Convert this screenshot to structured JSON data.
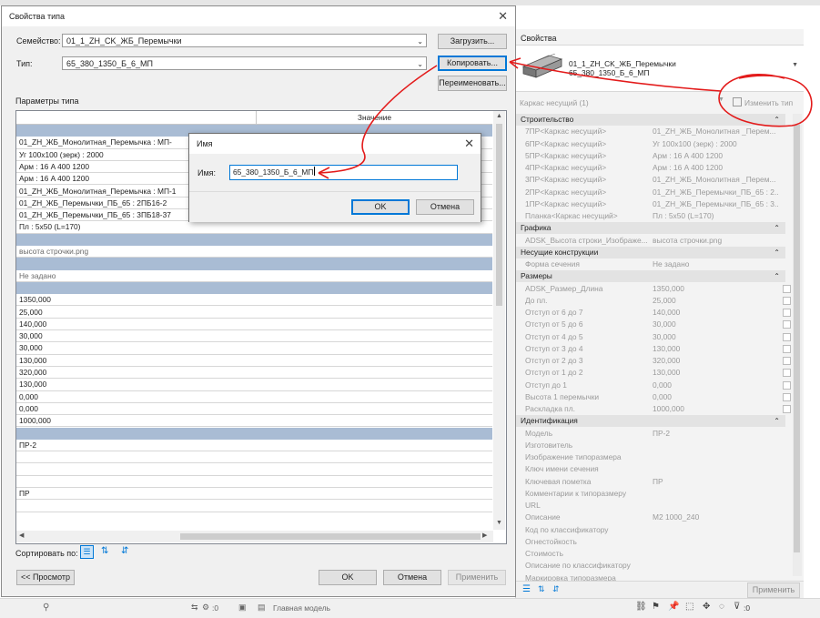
{
  "dialog": {
    "title": "Свойства типа",
    "family_label": "Семейство:",
    "family_value": "01_1_ZH_CK_ЖБ_Перемычки",
    "type_label": "Тип:",
    "type_value": "65_380_1350_Б_6_МП",
    "load_button": "Загрузить...",
    "copy_button": "Копировать...",
    "rename_button": "Переименовать...",
    "params_label": "Параметры типа",
    "column_header": "Значение",
    "sort_label": "Сортировать по:",
    "preview_button": "<< Просмотр",
    "ok_button": "OK",
    "cancel_button": "Отмена",
    "apply_button": "Применить",
    "rows": [
      {
        "text": "",
        "band": true
      },
      {
        "text": "01_ZH_ЖБ_Монолитная_Перемычка : МП-",
        "band": false
      },
      {
        "text": "Уг 100x100 (зерк) : 2000",
        "band": false
      },
      {
        "text": "Арм : 16 A 400 1200",
        "band": false
      },
      {
        "text": "Арм : 16 A 400 1200",
        "band": false
      },
      {
        "text": "01_ZH_ЖБ_Монолитная_Перемычка : МП-1",
        "band": false
      },
      {
        "text": "01_ZH_ЖБ_Перемычки_ПБ_65 : 2ПБ16-2",
        "band": false
      },
      {
        "text": "01_ZH_ЖБ_Перемычки_ПБ_65 : 3ПБ18-37",
        "band": false
      },
      {
        "text": "Пл : 5x50 (L=170)",
        "band": false
      },
      {
        "text": "",
        "band": true
      },
      {
        "text": "высота строчки.png",
        "band": false,
        "gray": true
      },
      {
        "text": "",
        "band": true
      },
      {
        "text": "Не задано",
        "band": false,
        "gray": true
      },
      {
        "text": "",
        "band": true
      },
      {
        "text": "1350,000",
        "band": false
      },
      {
        "text": "25,000",
        "band": false
      },
      {
        "text": "140,000",
        "band": false
      },
      {
        "text": "30,000",
        "band": false
      },
      {
        "text": "30,000",
        "band": false
      },
      {
        "text": "130,000",
        "band": false
      },
      {
        "text": "320,000",
        "band": false
      },
      {
        "text": "130,000",
        "band": false
      },
      {
        "text": "0,000",
        "band": false
      },
      {
        "text": "0,000",
        "band": false
      },
      {
        "text": "1000,000",
        "band": false
      },
      {
        "text": "",
        "band": true
      },
      {
        "text": "ПР-2",
        "band": false
      },
      {
        "text": "",
        "band": false
      },
      {
        "text": "",
        "band": false
      },
      {
        "text": "",
        "band": false
      },
      {
        "text": "ПР",
        "band": false
      },
      {
        "text": "",
        "band": false
      }
    ]
  },
  "name_dialog": {
    "title": "Имя",
    "name_label": "Имя:",
    "name_value": "65_380_1350_Б_6_МП",
    "ok_button": "OK",
    "cancel_button": "Отмена"
  },
  "properties": {
    "title": "Свойства",
    "type_line1": "01_1_ZH_CK_ЖБ_Перемычки",
    "type_line2": "65_380_1350_Б_6_МП",
    "instance_filter": "Каркас несущий (1)",
    "edit_type_button": "Изменить тип",
    "apply_button": "Применить",
    "rows": [
      {
        "section": true,
        "key": "Строительство"
      },
      {
        "key": "7ПР<Каркас несущий>",
        "value": "01_ZH_ЖБ_Монолитная _Перем..."
      },
      {
        "key": "6ПР<Каркас несущий>",
        "value": "Уг 100x100 (зерк) : 2000"
      },
      {
        "key": "5ПР<Каркас несущий>",
        "value": "Арм : 16 A 400 1200"
      },
      {
        "key": "4ПР<Каркас несущий>",
        "value": "Арм : 16 A 400 1200"
      },
      {
        "key": "3ПР<Каркас несущий>",
        "value": "01_ZH_ЖБ_Монолитная _Перем..."
      },
      {
        "key": "2ПР<Каркас несущий>",
        "value": "01_ZH_ЖБ_Перемычки_ПБ_65 : 2..."
      },
      {
        "key": "1ПР<Каркас несущий>",
        "value": "01_ZH_ЖБ_Перемычки_ПБ_65 : 3..."
      },
      {
        "key": "Планка<Каркас несущий>",
        "value": "Пл : 5x50 (L=170)"
      },
      {
        "section": true,
        "key": "Графика"
      },
      {
        "key": "ADSK_Высота строки_Изображе...",
        "value": "высота строчки.png"
      },
      {
        "section": true,
        "key": "Несущие конструкции"
      },
      {
        "key": "Форма сечения",
        "value": "Не задано"
      },
      {
        "section": true,
        "key": "Размеры"
      },
      {
        "key": "ADSK_Размер_Длина",
        "value": "1350,000",
        "check": true
      },
      {
        "key": "До пл.",
        "value": "25,000",
        "check": true
      },
      {
        "key": "Отступ от 6 до 7",
        "value": "140,000",
        "check": true
      },
      {
        "key": "Отступ от 5 до 6",
        "value": "30,000",
        "check": true
      },
      {
        "key": "Отступ от 4 до 5",
        "value": "30,000",
        "check": true
      },
      {
        "key": "Отступ от 3 до 4",
        "value": "130,000",
        "check": true
      },
      {
        "key": "Отступ от 2 до 3",
        "value": "320,000",
        "check": true
      },
      {
        "key": "Отступ от 1 до 2",
        "value": "130,000",
        "check": true
      },
      {
        "key": "Отступ до 1",
        "value": "0,000",
        "check": true
      },
      {
        "key": "Высота 1 перемычки",
        "value": "0,000",
        "check": true
      },
      {
        "key": "Раскладка пл.",
        "value": "1000,000",
        "check": true
      },
      {
        "section": true,
        "key": "Идентификация"
      },
      {
        "key": "Модель",
        "value": "ПР-2"
      },
      {
        "key": "Изготовитель",
        "value": ""
      },
      {
        "key": "Изображение типоразмера",
        "value": ""
      },
      {
        "key": "Ключ имени сечения",
        "value": ""
      },
      {
        "key": "Ключевая пометка",
        "value": "ПР"
      },
      {
        "key": "Комментарии к типоразмеру",
        "value": ""
      },
      {
        "key": "URL",
        "value": ""
      },
      {
        "key": "Описание",
        "value": "М2 1000_240"
      },
      {
        "key": "Код по классификатору",
        "value": ""
      },
      {
        "key": "Огнестойкость",
        "value": ""
      },
      {
        "key": "Стоимость",
        "value": ""
      },
      {
        "key": "Описание по классификатору",
        "value": ""
      },
      {
        "key": "Маркировка типоразмера",
        "value": ""
      }
    ]
  },
  "status_bar": {
    "coord_value": ":0",
    "model_label": "Главная модель",
    "filter_count": ":0"
  },
  "colors": {
    "accent": "#0078d7",
    "annotation": "#e31b1b",
    "band": "#a9bcd4"
  }
}
